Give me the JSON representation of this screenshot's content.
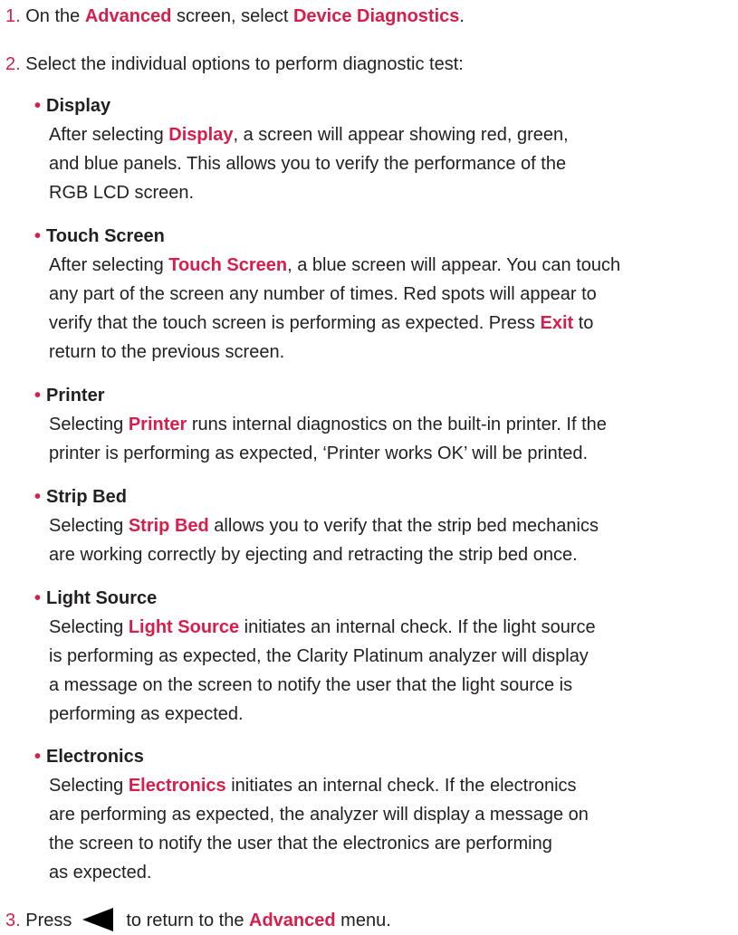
{
  "colors": {
    "accent": "#d71e4b",
    "text": "#231f20"
  },
  "step1": {
    "num": "1.",
    "t1": "On the ",
    "h1": "Advanced",
    "t2": " screen, select ",
    "h2": "Device Diagnostics",
    "t3": "."
  },
  "step2": {
    "num": "2.",
    "text": "Select the individual options to perform diagnostic test:"
  },
  "items": {
    "display": {
      "title": "Display",
      "lines": [
        [
          "After selecting ",
          "Display",
          ", a screen will appear showing red, green,"
        ],
        "and blue panels. This allows you to verify the performance of the",
        "RGB LCD screen."
      ]
    },
    "touch": {
      "title": "Touch Screen",
      "lines": [
        [
          "After selecting ",
          "Touch Screen",
          ", a blue screen will appear. You can touch"
        ],
        "any part of the screen any number of times. Red spots will appear to",
        [
          "verify that the touch screen is performing as expected. Press ",
          "Exit",
          " to"
        ],
        "return to the previous screen."
      ]
    },
    "printer": {
      "title": "Printer",
      "lines": [
        [
          "Selecting ",
          "Printer",
          " runs internal diagnostics on the built-in printer. If the"
        ],
        "printer is performing as expected, ‘Printer works OK’ will be printed."
      ]
    },
    "strip": {
      "title": "Strip Bed",
      "lines": [
        [
          "Selecting ",
          "Strip Bed",
          " allows you to verify that the strip bed mechanics"
        ],
        "are working correctly by ejecting and retracting the strip bed once."
      ]
    },
    "light": {
      "title": "Light Source",
      "lines": [
        [
          "Selecting ",
          "Light Source",
          " initiates an internal check. If the light source"
        ],
        "is performing as expected, the Clarity Platinum analyzer will display",
        "a message on the screen to notify the user that the light source is",
        "performing as expected."
      ]
    },
    "electronics": {
      "title": "Electronics",
      "lines": [
        [
          "Selecting ",
          "Electronics",
          " initiates an internal check. If the electronics"
        ],
        "are performing as expected, the analyzer will display a message on",
        "the screen to notify the user that the electronics are performing",
        "as expected."
      ]
    }
  },
  "step3": {
    "num": "3.",
    "t1": "Press",
    "icon": "back-arrow-icon",
    "t2": "to return to the ",
    "h1": "Advanced",
    "t3": " menu."
  }
}
